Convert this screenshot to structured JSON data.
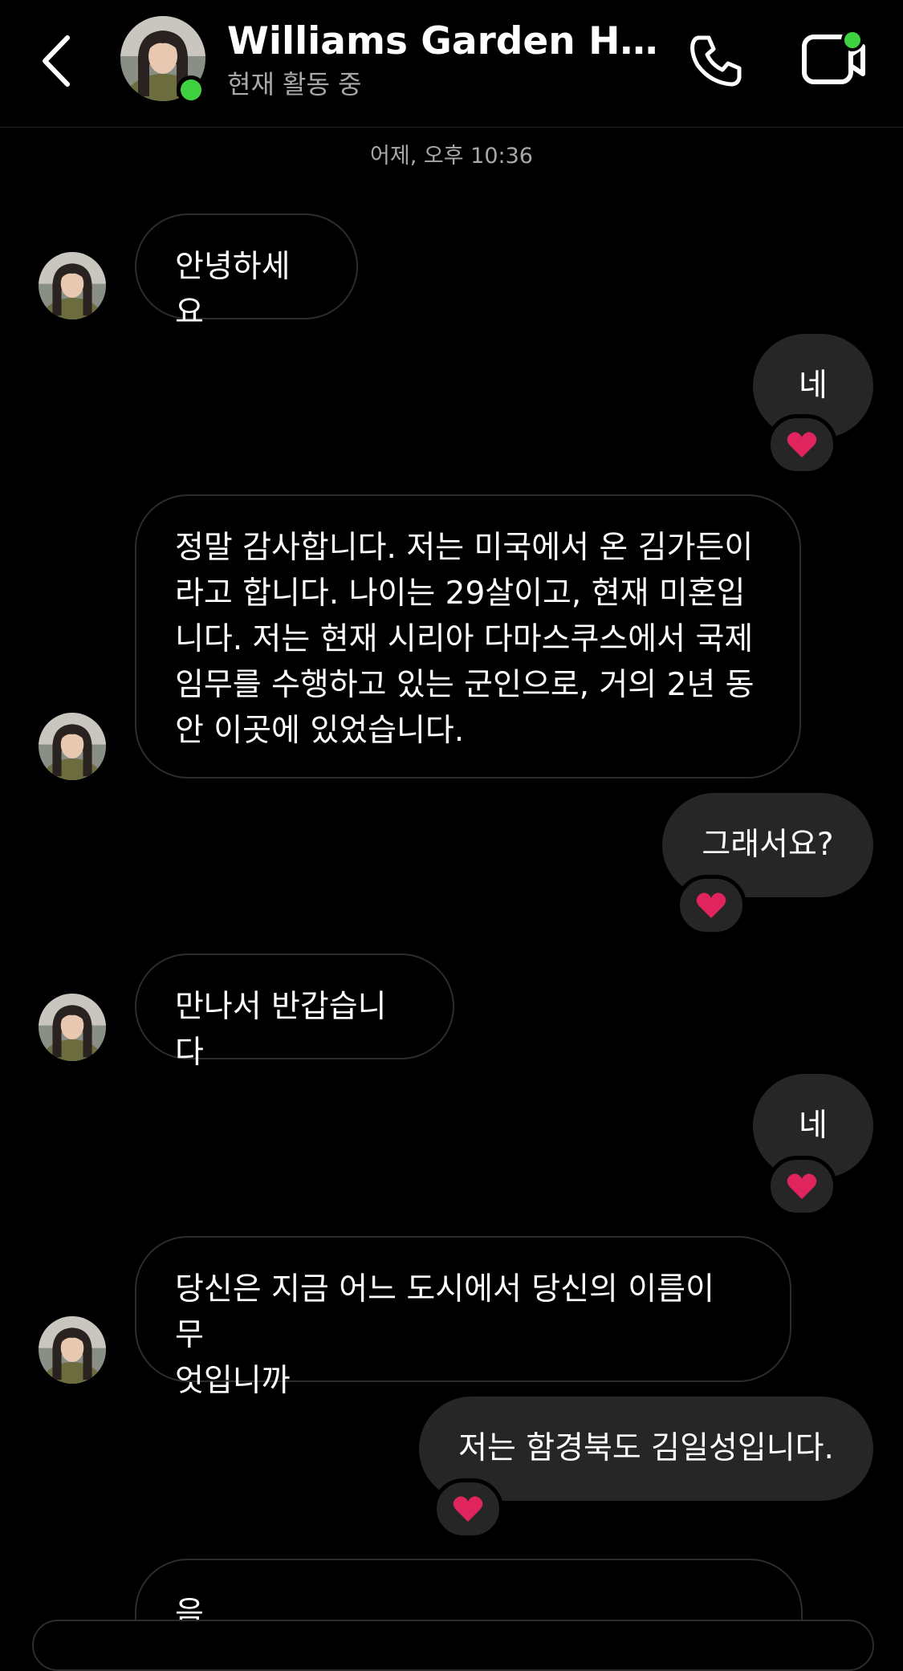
{
  "header": {
    "title": "Williams Garden Han...",
    "status": "현재 활동 중",
    "online_color": "#3fd13f",
    "icons": [
      "chevron-left-icon",
      "phone-icon",
      "video-call-icon"
    ]
  },
  "thread": {
    "timestamp": "어제, 오후 10:36",
    "messages": [
      {
        "from": "them",
        "text": "안녕하세요"
      },
      {
        "from": "me",
        "text": "네",
        "reaction": "heart"
      },
      {
        "from": "them",
        "text": "정말 감사합니다. 저는 미국에서 온 김가든이\n라고 합니다. 나이는 29살이고, 현재 미혼입\n니다. 저는 현재 시리아 다마스쿠스에서 국제\n임무를 수행하고 있는 군인으로, 거의 2년 동\n안 이곳에 있었습니다."
      },
      {
        "from": "me",
        "text": "그래서요?",
        "reaction": "heart"
      },
      {
        "from": "them",
        "text": "만나서 반갑습니다"
      },
      {
        "from": "me",
        "text": "네",
        "reaction": "heart"
      },
      {
        "from": "them",
        "text": "당신은 지금 어느 도시에서 당신의 이름이 무\n엇입니까"
      },
      {
        "from": "me",
        "text": "저는 함경북도 김일성입니다.",
        "reaction": "heart"
      },
      {
        "from": "them",
        "text": "음."
      }
    ]
  },
  "colors": {
    "background": "#000000",
    "outgoing_bubble": "#262626",
    "incoming_border": "#2c2c2c",
    "secondary_text": "#a8a8a8",
    "reaction_heart": "#e0245e"
  }
}
